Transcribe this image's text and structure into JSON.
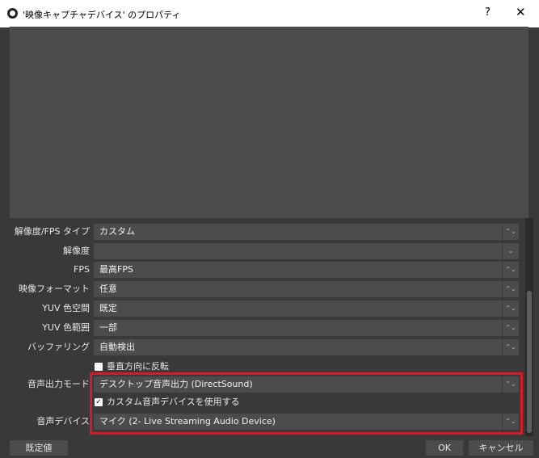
{
  "window": {
    "title": "'映像キャプチャデバイス' のプロパティ",
    "help": "?",
    "close": "✕"
  },
  "properties": [
    {
      "label": "解像度/FPS タイプ",
      "value": "カスタム",
      "arrow": "⌃⌄"
    },
    {
      "label": "解像度",
      "value": "",
      "arrow": "⌄"
    },
    {
      "label": "FPS",
      "value": "最高FPS",
      "arrow": "⌃⌄"
    },
    {
      "label": "映像フォーマット",
      "value": "任意",
      "arrow": "⌃⌄"
    },
    {
      "label": "YUV 色空間",
      "value": "既定",
      "arrow": "⌃⌄"
    },
    {
      "label": "YUV 色範囲",
      "value": "一部",
      "arrow": "⌃⌄"
    },
    {
      "label": "バッファリング",
      "value": "自動検出",
      "arrow": "⌃⌄"
    }
  ],
  "flip_checkbox": {
    "label": "垂直方向に反転",
    "checked": false
  },
  "audio_output": {
    "label": "音声出力モード",
    "value": "デスクトップ音声出力 (DirectSound)",
    "arrow": "⌃⌄"
  },
  "custom_audio_checkbox": {
    "label": "カスタム音声デバイスを使用する",
    "checked": true,
    "mark": "✓"
  },
  "audio_device": {
    "label": "音声デバイス",
    "value": "マイク (2- Live Streaming Audio Device)",
    "arrow": "⌃⌄"
  },
  "buttons": {
    "defaults": "既定値",
    "ok": "OK",
    "cancel": "キャンセル"
  },
  "colors": {
    "background": "#3a393a",
    "field": "#4c4c4c",
    "highlight": "#d8182b"
  }
}
